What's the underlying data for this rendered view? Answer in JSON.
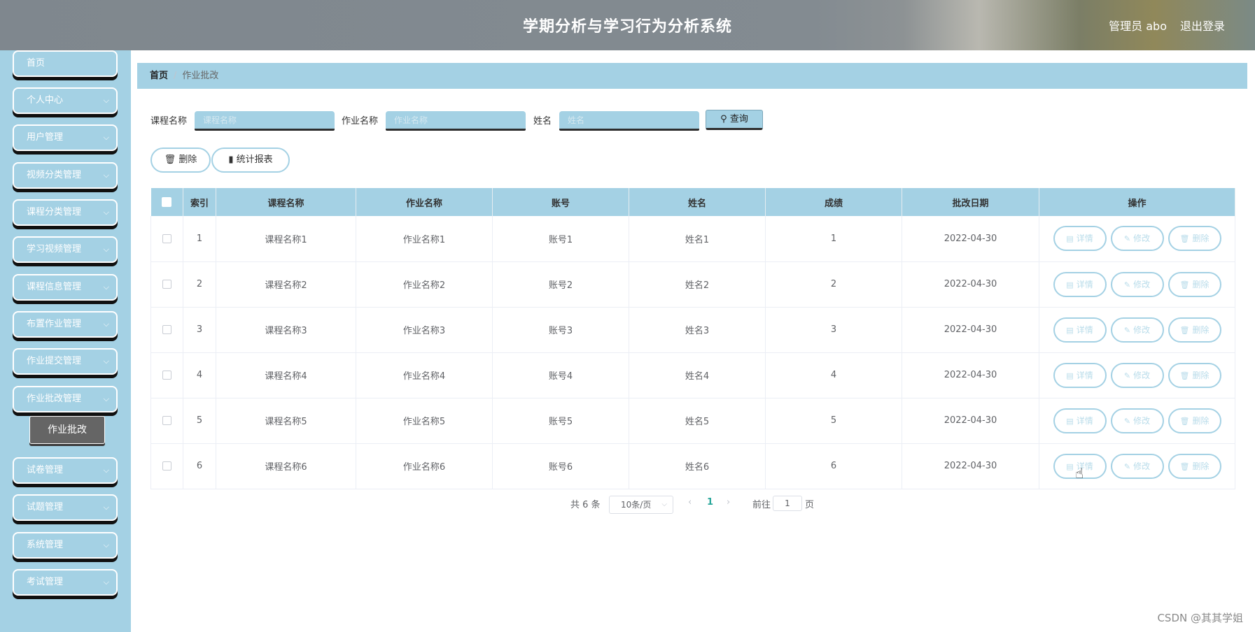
{
  "header": {
    "title": "学期分析与学习行为分析系统",
    "user": "管理员 abo",
    "logout": "退出登录"
  },
  "sidebar": {
    "items": [
      {
        "label": "首页"
      },
      {
        "label": "个人中心"
      },
      {
        "label": "用户管理"
      },
      {
        "label": "视频分类管理"
      },
      {
        "label": "课程分类管理"
      },
      {
        "label": "学习视频管理"
      },
      {
        "label": "课程信息管理"
      },
      {
        "label": "布置作业管理"
      },
      {
        "label": "作业提交管理"
      },
      {
        "label": "作业批改管理"
      },
      {
        "label": "试卷管理"
      },
      {
        "label": "试题管理"
      },
      {
        "label": "系统管理"
      },
      {
        "label": "考试管理"
      }
    ],
    "active_sub": "作业批改"
  },
  "breadcrumb": {
    "home": "首页",
    "separator": "/",
    "current": "作业批改"
  },
  "search": {
    "course_label": "课程名称",
    "course_placeholder": "课程名称",
    "homework_label": "作业名称",
    "homework_placeholder": "作业名称",
    "name_label": "姓名",
    "name_placeholder": "姓名",
    "query": "查询"
  },
  "actions": {
    "delete": "删除",
    "report": "统计报表"
  },
  "table": {
    "headers": [
      "索引",
      "课程名称",
      "作业名称",
      "账号",
      "姓名",
      "成绩",
      "批改日期",
      "操作"
    ],
    "rows": [
      [
        "1",
        "课程名称1",
        "作业名称1",
        "账号1",
        "姓名1",
        "1",
        "2022-04-30"
      ],
      [
        "2",
        "课程名称2",
        "作业名称2",
        "账号2",
        "姓名2",
        "2",
        "2022-04-30"
      ],
      [
        "3",
        "课程名称3",
        "作业名称3",
        "账号3",
        "姓名3",
        "3",
        "2022-04-30"
      ],
      [
        "4",
        "课程名称4",
        "作业名称4",
        "账号4",
        "姓名4",
        "4",
        "2022-04-30"
      ],
      [
        "5",
        "课程名称5",
        "作业名称5",
        "账号5",
        "姓名5",
        "5",
        "2022-04-30"
      ],
      [
        "6",
        "课程名称6",
        "作业名称6",
        "账号6",
        "姓名6",
        "6",
        "2022-04-30"
      ]
    ],
    "ops": {
      "detail": "详情",
      "edit": "修改",
      "delete": "删除"
    }
  },
  "pagination": {
    "total": "共 6 条",
    "page_size": "10条/页",
    "current_page": "1",
    "goto_prefix": "前往",
    "goto_value": "1",
    "goto_suffix": "页"
  },
  "watermark": "CSDN @其其学姐",
  "colors": {
    "accent": "#a4d1e4",
    "active_sub": "#656565",
    "page_active": "#2aa79b"
  }
}
